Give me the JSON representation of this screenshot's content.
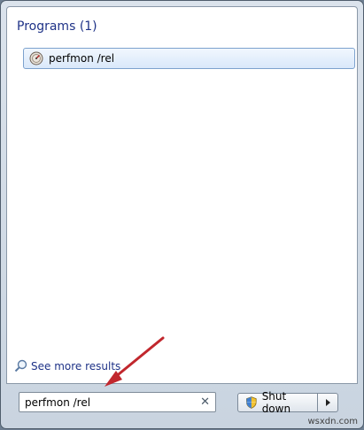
{
  "results": {
    "section_header": "Programs (1)",
    "items": [
      {
        "label": "perfmon /rel",
        "icon": "performance-monitor-icon"
      }
    ]
  },
  "see_more": {
    "label": "See more results",
    "icon": "search-icon"
  },
  "search": {
    "value": "perfmon /rel",
    "clear_icon": "✕"
  },
  "power": {
    "shutdown_label": "Shut down",
    "shield_icon": "uac-shield-icon",
    "arrow_icon": "triangle-right"
  },
  "annotation": {
    "color": "#c1272d"
  },
  "watermark": "wsxdn.com",
  "colors": {
    "header": "#1e3287",
    "highlight_border": "#7da2ce"
  }
}
